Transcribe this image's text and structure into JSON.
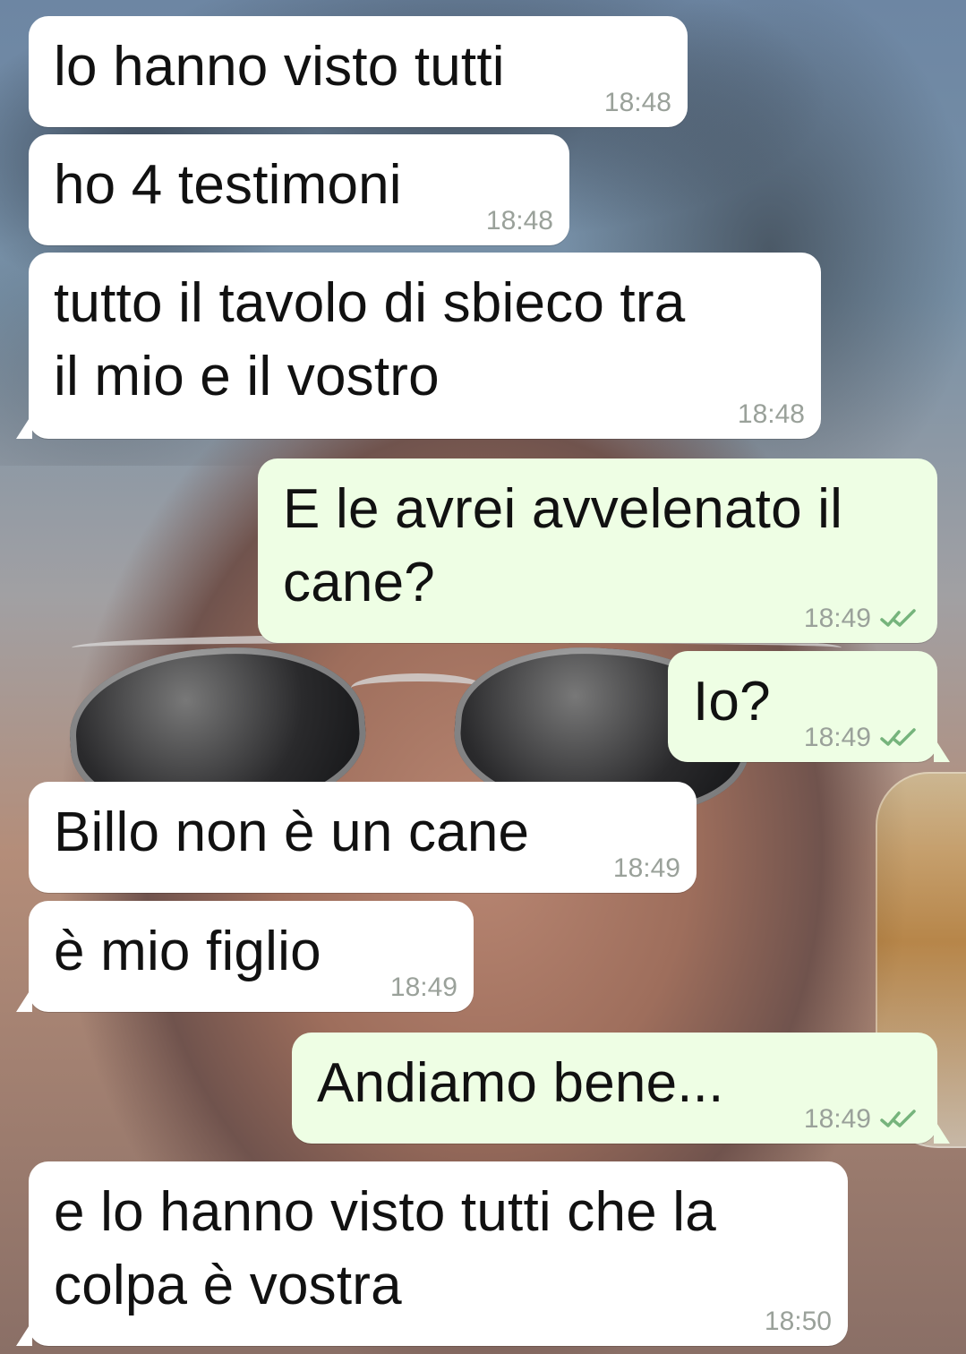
{
  "messages": [
    {
      "text": "lo hanno visto tutti",
      "time": "18:48",
      "direction": "incoming"
    },
    {
      "text": "ho 4 testimoni",
      "time": "18:48",
      "direction": "incoming"
    },
    {
      "text": "tutto il tavolo di sbieco tra\nil mio e il vostro",
      "time": "18:48",
      "direction": "incoming"
    },
    {
      "text": "E le avrei avvelenato il\ncane?",
      "time": "18:49",
      "direction": "outgoing",
      "status_icon": "double-check-icon"
    },
    {
      "text": "Io?",
      "time": "18:49",
      "direction": "outgoing",
      "status_icon": "double-check-icon"
    },
    {
      "text": "Billo non è un cane",
      "time": "18:49",
      "direction": "incoming"
    },
    {
      "text": "è mio figlio",
      "time": "18:49",
      "direction": "incoming"
    },
    {
      "text": "Andiamo bene...",
      "time": "18:49",
      "direction": "outgoing",
      "status_icon": "double-check-icon"
    },
    {
      "text": "e lo hanno visto tutti che la\ncolpa è vostra",
      "time": "18:50",
      "direction": "incoming"
    }
  ],
  "colors": {
    "incoming_bubble": "#ffffff",
    "outgoing_bubble": "#eefee4",
    "message_text": "#111111",
    "meta_text": "#9aa19a",
    "read_check": "#76b47c"
  }
}
